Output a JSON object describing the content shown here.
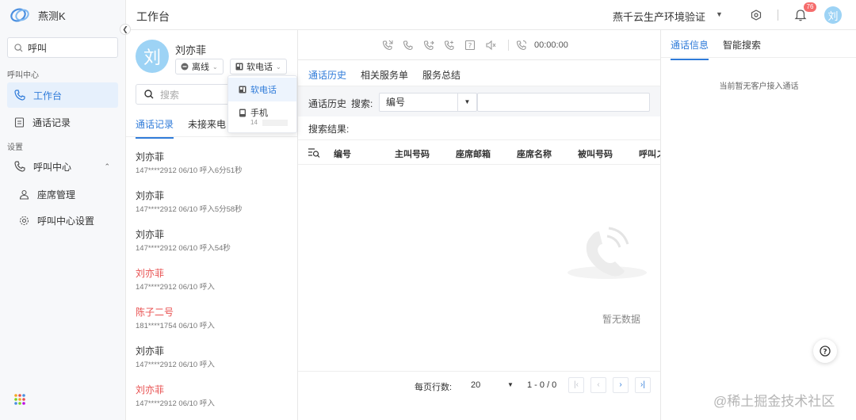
{
  "app": {
    "name": "燕测K"
  },
  "sidebar": {
    "search_value": "呼叫",
    "group_call_center": "呼叫中心",
    "item_workbench": "工作台",
    "item_call_records": "通话记录",
    "group_settings": "设置",
    "item_call_center": "呼叫中心",
    "item_seat_mgmt": "座席管理",
    "item_call_center_settings": "呼叫中心设置"
  },
  "header": {
    "title": "工作台",
    "environment": "燕千云生产环境验证",
    "notification_count": "76",
    "avatar_initial": "刘"
  },
  "agent": {
    "avatar_initial": "刘",
    "name": "刘亦菲",
    "status": "离线",
    "phone_mode": "软电话",
    "search_placeholder": "搜索"
  },
  "phone_menu": {
    "option_softphone": "软电话",
    "option_mobile": "手机",
    "mobile_partial": "14"
  },
  "contact_tabs": {
    "history": "通话记录",
    "missed": "未接来电"
  },
  "calls": [
    {
      "name": "刘亦菲",
      "meta": "147****2912  06/10  呼入6分51秒",
      "missed": false
    },
    {
      "name": "刘亦菲",
      "meta": "147****2912  06/10  呼入5分58秒",
      "missed": false
    },
    {
      "name": "刘亦菲",
      "meta": "147****2912  06/10  呼入54秒",
      "missed": false
    },
    {
      "name": "刘亦菲",
      "meta": "147****2912  06/10  呼入",
      "missed": true
    },
    {
      "name": "陈子二号",
      "meta": "181****1754  06/10  呼入",
      "missed": true
    },
    {
      "name": "刘亦菲",
      "meta": "147****2912  06/10  呼入",
      "missed": false
    },
    {
      "name": "刘亦菲",
      "meta": "147****2912  06/10  呼入",
      "missed": true
    }
  ],
  "call_toolbar": {
    "timer": "00:00:00"
  },
  "middle_tabs": {
    "history": "通话历史",
    "tickets": "相关服务单",
    "summary": "服务总结"
  },
  "filter": {
    "label": "通话历史",
    "search_label": "搜索:",
    "field_value": "编号"
  },
  "results_label": "搜索结果:",
  "table": {
    "columns": [
      "编号",
      "主叫号码",
      "座席邮箱",
      "座席名称",
      "被叫号码",
      "呼叫ス"
    ]
  },
  "empty_text": "暂无数据",
  "pagination": {
    "rows_label": "每页行数:",
    "rows_per_page": "20",
    "range": "1 - 0 / 0"
  },
  "right_tabs": {
    "call_info": "通话信息",
    "smart_search": "智能搜索"
  },
  "right_empty": "当前暂无客户接入通话",
  "watermark": "@稀土掘金技术社区",
  "colors": {
    "accent": "#2f7bd9",
    "missed": "#e85050",
    "badge": "#f56c6c",
    "avatar": "#9dd3f5"
  }
}
